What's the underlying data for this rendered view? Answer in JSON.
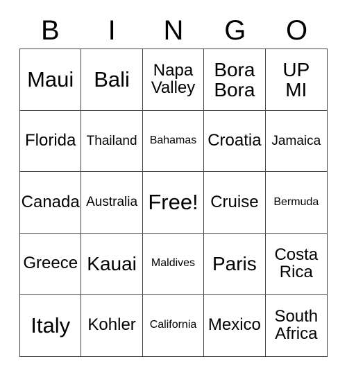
{
  "card": {
    "header": {
      "letters": [
        "B",
        "I",
        "N",
        "G",
        "O"
      ]
    },
    "cells": [
      {
        "text": "Maui",
        "size": "xl"
      },
      {
        "text": "Bali",
        "size": "xl"
      },
      {
        "text": "Napa\nValley",
        "size": "md"
      },
      {
        "text": "Bora\nBora",
        "size": "lg"
      },
      {
        "text": "UP\nMI",
        "size": "lg"
      },
      {
        "text": "Florida",
        "size": "md"
      },
      {
        "text": "Thailand",
        "size": "sm"
      },
      {
        "text": "Bahamas",
        "size": "xs"
      },
      {
        "text": "Croatia",
        "size": "md"
      },
      {
        "text": "Jamaica",
        "size": "sm"
      },
      {
        "text": "Canada",
        "size": "md"
      },
      {
        "text": "Australia",
        "size": "sm"
      },
      {
        "text": "Free!",
        "size": "xl"
      },
      {
        "text": "Cruise",
        "size": "md"
      },
      {
        "text": "Bermuda",
        "size": "xs"
      },
      {
        "text": "Greece",
        "size": "md"
      },
      {
        "text": "Kauai",
        "size": "lg"
      },
      {
        "text": "Maldives",
        "size": "xs"
      },
      {
        "text": "Paris",
        "size": "lg"
      },
      {
        "text": "Costa\nRica",
        "size": "md"
      },
      {
        "text": "Italy",
        "size": "xl"
      },
      {
        "text": "Kohler",
        "size": "md"
      },
      {
        "text": "California",
        "size": "xs"
      },
      {
        "text": "Mexico",
        "size": "md"
      },
      {
        "text": "South\nAfrica",
        "size": "md"
      }
    ],
    "colors": {
      "background": "#ffffff",
      "text": "#000000",
      "grid_line": "#444444"
    }
  }
}
